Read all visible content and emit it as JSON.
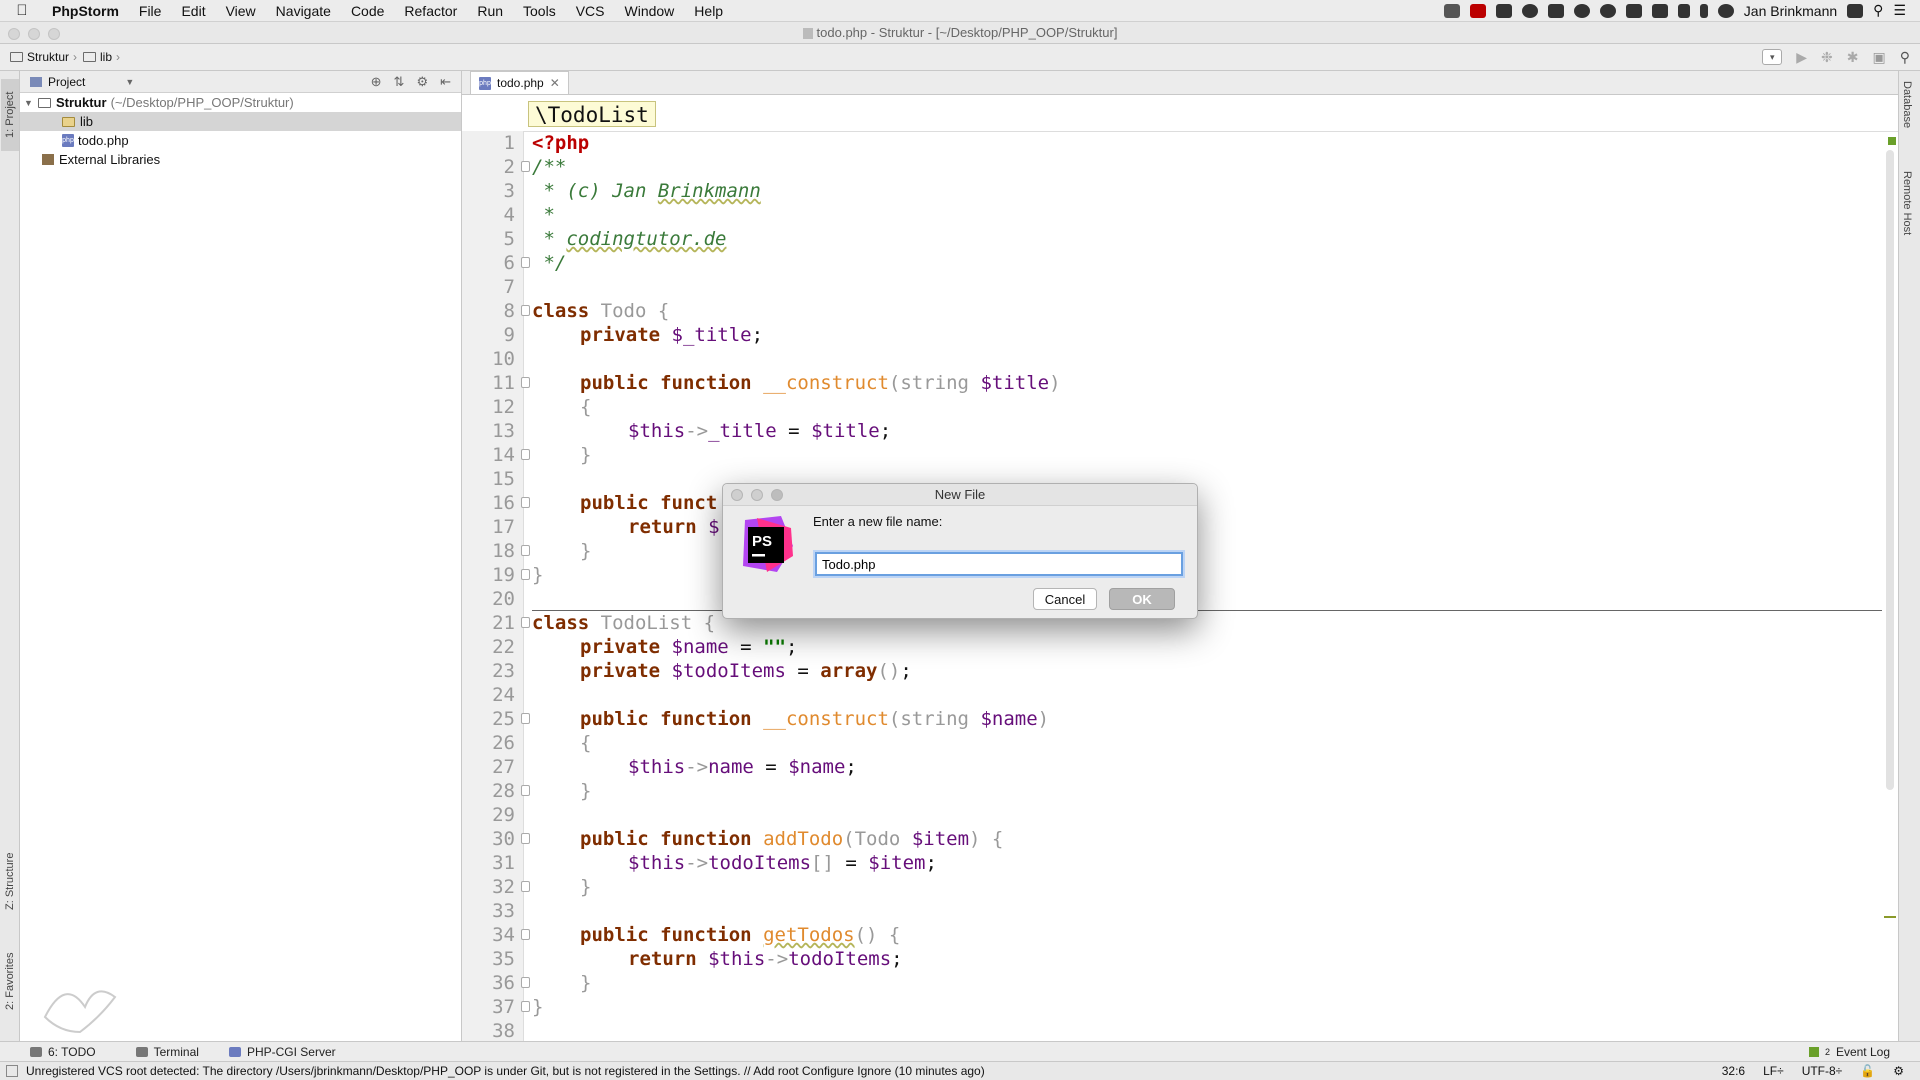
{
  "menubar": {
    "app": "PhpStorm",
    "items": [
      "File",
      "Edit",
      "View",
      "Navigate",
      "Code",
      "Refactor",
      "Run",
      "Tools",
      "VCS",
      "Window",
      "Help"
    ],
    "user": "Jan Brinkmann"
  },
  "window": {
    "title": "todo.php - Struktur - [~/Desktop/PHP_OOP/Struktur]"
  },
  "navbar": {
    "crumb1": "Struktur",
    "crumb2": "lib"
  },
  "left_strip": {
    "project": "1: Project",
    "structure": "Z: Structure",
    "favorites": "2: Favorites"
  },
  "right_strip": {
    "database": "Database",
    "remote": "Remote Host"
  },
  "project_panel": {
    "header": "Project",
    "root_name": "Struktur",
    "root_path": "(~/Desktop/PHP_OOP/Struktur)",
    "folder": "lib",
    "file": "todo.php",
    "ext": "External Libraries"
  },
  "editor": {
    "tab": "todo.php",
    "class_crumb": "\\TodoList",
    "line_numbers": [
      "1",
      "2",
      "3",
      "4",
      "5",
      "6",
      "7",
      "8",
      "9",
      "10",
      "11",
      "12",
      "13",
      "14",
      "15",
      "16",
      "17",
      "18",
      "19",
      "20",
      "21",
      "22",
      "23",
      "24",
      "25",
      "26",
      "27",
      "28",
      "29",
      "30",
      "31",
      "32",
      "33",
      "34",
      "35",
      "36",
      "37",
      "38"
    ]
  },
  "code": {
    "l1": "<?php",
    "l2": "/**",
    "l3a": " * (c) Jan ",
    "l3b": "Brinkmann",
    "l4": " *",
    "l5a": " * ",
    "l5b": "codingtutor.de",
    "l6": " */",
    "kw_class": "class",
    "todo_name": "Todo",
    "brace_open": "{",
    "brace_close": "}",
    "private": "private",
    "public": "public",
    "function": "function",
    "construct": "__construct",
    "string": "string",
    "var_title_prop": "$_title",
    "var_title": "$title",
    "this": "$this",
    "arrow": "->",
    "title_prop": "_title",
    "eq": " = ",
    "semi": ";",
    "paren_o": "(",
    "paren_c": ")",
    "l16_partial": "funct",
    "return": "return",
    "l17_partial": "$",
    "todolist_name": "TodoList",
    "var_name": "$name",
    "empty_str": "\"\"",
    "var_items": "$todoItems",
    "array": "array",
    "name_prop": "name",
    "addTodo": "addTodo",
    "todo_type": "Todo",
    "var_item": "$item",
    "items_prop": "todoItems",
    "brackets": "[]",
    "getTodos": "getTodos",
    "empty_parens": "()"
  },
  "dialog": {
    "title": "New File",
    "prompt": "Enter a new file name:",
    "value": "Todo.php",
    "cancel": "Cancel",
    "ok": "OK",
    "logo_text": "PS"
  },
  "bottom_tools": {
    "todo": "6: TODO",
    "terminal": "Terminal",
    "server": "PHP-CGI Server",
    "eventlog": "Event Log",
    "eventcount": "2"
  },
  "status": {
    "message": "Unregistered VCS root detected: The directory /Users/jbrinkmann/Desktop/PHP_OOP is under Git, but is not registered in the Settings. // Add root  Configure  Ignore (10 minutes ago)",
    "position": "32:6",
    "lineSep": "LF÷",
    "encoding": "UTF-8÷"
  }
}
